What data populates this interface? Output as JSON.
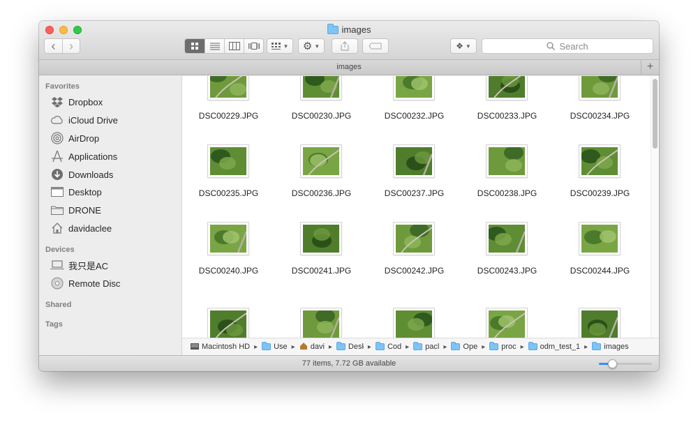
{
  "window": {
    "title": "images"
  },
  "toolbar": {
    "search_placeholder": "Search",
    "nav_back": "‹",
    "nav_forward": "›"
  },
  "pathhead": {
    "title": "images",
    "plus": "+"
  },
  "sidebar": {
    "sections": [
      {
        "label": "Favorites",
        "items": [
          {
            "label": "Dropbox",
            "icon": "dropbox-icon"
          },
          {
            "label": "iCloud Drive",
            "icon": "cloud-icon"
          },
          {
            "label": "AirDrop",
            "icon": "airdrop-icon"
          },
          {
            "label": "Applications",
            "icon": "applications-icon"
          },
          {
            "label": "Downloads",
            "icon": "downloads-icon"
          },
          {
            "label": "Desktop",
            "icon": "desktop-icon"
          },
          {
            "label": "DRONE",
            "icon": "folder-icon"
          },
          {
            "label": "davidaclee",
            "icon": "home-icon"
          }
        ]
      },
      {
        "label": "Devices",
        "items": [
          {
            "label": "我只是AC",
            "icon": "laptop-icon"
          },
          {
            "label": "Remote Disc",
            "icon": "disc-icon"
          }
        ]
      },
      {
        "label": "Shared",
        "items": []
      },
      {
        "label": "Tags",
        "items": []
      }
    ]
  },
  "files": [
    "DSC00229.JPG",
    "DSC00230.JPG",
    "DSC00232.JPG",
    "DSC00233.JPG",
    "DSC00234.JPG",
    "DSC00235.JPG",
    "DSC00236.JPG",
    "DSC00237.JPG",
    "DSC00238.JPG",
    "DSC00239.JPG",
    "DSC00240.JPG",
    "DSC00241.JPG",
    "DSC00242.JPG",
    "DSC00243.JPG",
    "DSC00244.JPG"
  ],
  "breadcrumb": [
    "Macintosh HD",
    "Use",
    "davi",
    "Desk",
    "Cod",
    "pacl",
    "Ope",
    "proc",
    "odm_test_1",
    "images"
  ],
  "status": {
    "text": "77 items, 7.72 GB available",
    "icon_size_level": 0.25
  },
  "colors": {
    "accent": "#3b8af7",
    "folder": "#7ec4f4",
    "sidebar": "#ededed"
  }
}
